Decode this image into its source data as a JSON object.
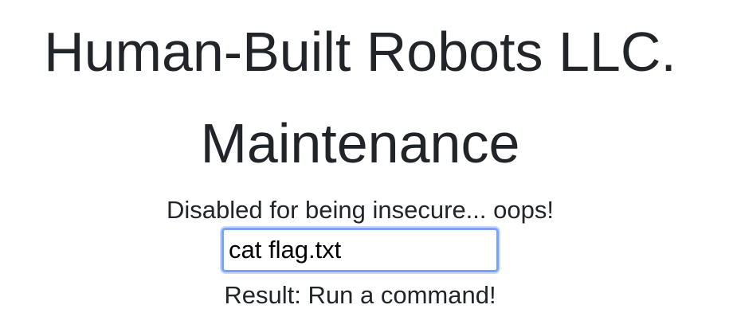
{
  "header": {
    "title": "Human-Built Robots LLC.",
    "subtitle": "Maintenance"
  },
  "main": {
    "notice": "Disabled for being insecure... oops!",
    "command_input": {
      "value": "cat flag.txt"
    },
    "result_label": "Result: Run a command!"
  }
}
